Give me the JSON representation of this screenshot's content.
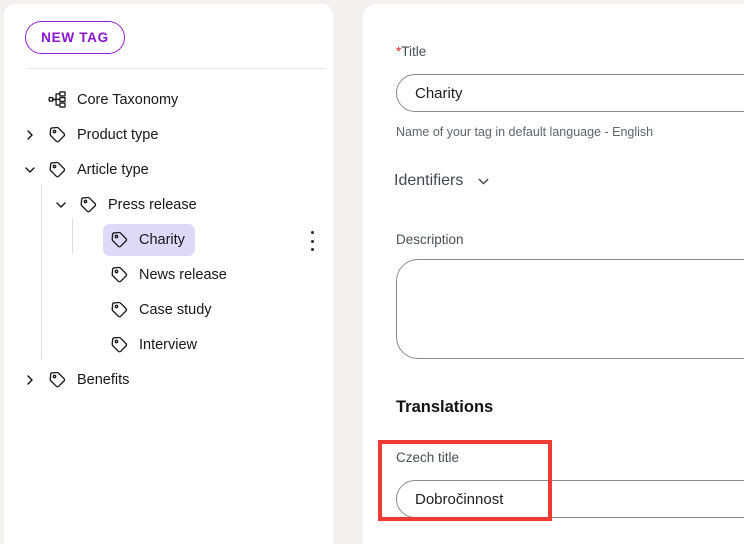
{
  "theme": {
    "page_background": "#f4f0ed",
    "panel_background": "#ffffff",
    "accent_purple": "#8a14cf",
    "selected_row": "#ddd9f7",
    "annotation_red": "#ee3b33",
    "required_star": "#e0322b"
  },
  "sidebar": {
    "new_tag_button": "NEW TAG",
    "kebab_icon": "more-vertical-icon",
    "items": [
      {
        "label": "Core Taxonomy",
        "icon": "hierarchy-icon",
        "indent": 0,
        "chevron": "none",
        "selected": false
      },
      {
        "label": "Product type",
        "icon": "tag-icon",
        "indent": 0,
        "chevron": "right",
        "selected": false
      },
      {
        "label": "Article type",
        "icon": "tag-icon",
        "indent": 0,
        "chevron": "down",
        "selected": false
      },
      {
        "label": "Press release",
        "icon": "tag-icon",
        "indent": 1,
        "chevron": "down",
        "selected": false
      },
      {
        "label": "Charity",
        "icon": "tag-icon",
        "indent": 2,
        "chevron": "none",
        "selected": true
      },
      {
        "label": "News release",
        "icon": "tag-icon",
        "indent": 2,
        "chevron": "none",
        "selected": false
      },
      {
        "label": "Case study",
        "icon": "tag-icon",
        "indent": 2,
        "chevron": "none",
        "selected": false
      },
      {
        "label": "Interview",
        "icon": "tag-icon",
        "indent": 2,
        "chevron": "none",
        "selected": false
      },
      {
        "label": "Benefits",
        "icon": "tag-icon",
        "indent": 0,
        "chevron": "right",
        "selected": false
      }
    ]
  },
  "detail": {
    "title_label_star": "*",
    "title_label": "Title",
    "title_value": "Charity",
    "title_placeholder": "",
    "title_hint": "Name of your tag in default language - English",
    "identifiers_label": "Identifiers",
    "identifiers_chevron_icon": "chevron-down-icon",
    "description_label": "Description",
    "description_value": "",
    "description_placeholder": "",
    "translations_heading": "Translations",
    "czech_label": "Czech title",
    "czech_value": "Dobročinnost",
    "czech_placeholder": ""
  }
}
